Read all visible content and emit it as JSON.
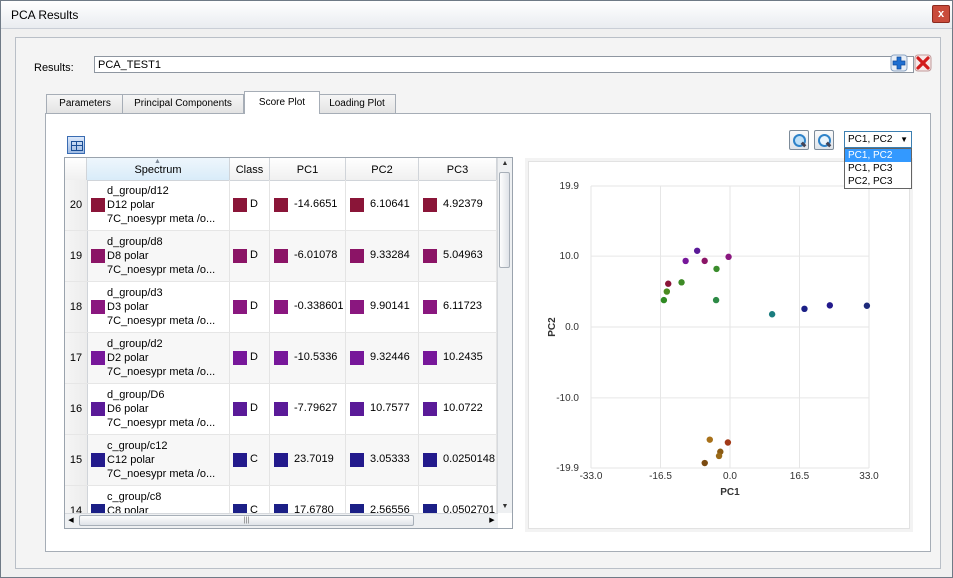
{
  "window": {
    "title": "PCA Results",
    "close_glyph": "x"
  },
  "results": {
    "label": "Results:",
    "value": "PCA_TEST1",
    "add_icon": "plus-icon",
    "delete_icon": "delete-x-icon"
  },
  "tabs": [
    {
      "label": "Parameters",
      "active": false
    },
    {
      "label": "Principal Components",
      "active": false
    },
    {
      "label": "Score Plot",
      "active": true
    },
    {
      "label": "Loading Plot",
      "active": false
    }
  ],
  "toolbar": {
    "pc_select_value": "PC1, PC2",
    "pc_options": [
      "PC1, PC2",
      "PC1, PC3",
      "PC2, PC3"
    ],
    "selected_option": "PC1, PC2"
  },
  "table": {
    "columns": [
      "Spectrum",
      "Class",
      "PC1",
      "PC2",
      "PC3"
    ],
    "rows": [
      {
        "num": "20",
        "spectrum": [
          "d_group/d12",
          "D12 polar",
          "7C_noesypr meta /o..."
        ],
        "class": "D",
        "pc1": "-14.6651",
        "pc2": "6.10641",
        "pc3": "4.92379",
        "color": "#8a1538"
      },
      {
        "num": "19",
        "spectrum": [
          "d_group/d8",
          "D8 polar",
          "7C_noesypr meta /o..."
        ],
        "class": "D",
        "pc1": "-6.01078",
        "pc2": "9.33284",
        "pc3": "5.04963",
        "color": "#8b1466"
      },
      {
        "num": "18",
        "spectrum": [
          "d_group/d3",
          "D3 polar",
          "7C_noesypr meta /o..."
        ],
        "class": "D",
        "pc1": "-0.338601",
        "pc2": "9.90141",
        "pc3": "6.11723",
        "color": "#8a177f"
      },
      {
        "num": "17",
        "spectrum": [
          "d_group/d2",
          "D2 polar",
          "7C_noesypr meta /o..."
        ],
        "class": "D",
        "pc1": "-10.5336",
        "pc2": "9.32446",
        "pc3": "10.2435",
        "color": "#77179a"
      },
      {
        "num": "16",
        "spectrum": [
          "d_group/D6",
          "D6 polar",
          "7C_noesypr meta /o..."
        ],
        "class": "D",
        "pc1": "-7.79627",
        "pc2": "10.7577",
        "pc3": "10.0722",
        "color": "#5a1a98"
      },
      {
        "num": "15",
        "spectrum": [
          "c_group/c12",
          "C12 polar",
          "7C_noesypr meta /o..."
        ],
        "class": "C",
        "pc1": "23.7019",
        "pc2": "3.05333",
        "pc3": "0.0250148",
        "color": "#231a8c"
      },
      {
        "num": "14",
        "spectrum": [
          "c_group/c8",
          "C8 polar",
          ""
        ],
        "class": "C",
        "pc1": "17.6780",
        "pc2": "2.56556",
        "pc3": "0.0502701",
        "color": "#1b1f86"
      }
    ]
  },
  "chart_data": {
    "type": "scatter",
    "xlabel": "PC1",
    "ylabel": "PC2",
    "xlim": [
      -33.0,
      33.0
    ],
    "ylim": [
      -19.9,
      19.9
    ],
    "xticks": [
      "-33.0",
      "-16.5",
      "0.0",
      "16.5",
      "33.0"
    ],
    "yticks": [
      "19.9",
      "10.0",
      "0.0",
      "-10.0",
      "-19.9"
    ],
    "grid": true,
    "points": [
      {
        "x": -14.6651,
        "y": 6.10641,
        "color": "#8a1538"
      },
      {
        "x": -6.01078,
        "y": 9.33284,
        "color": "#8b1466"
      },
      {
        "x": -0.338601,
        "y": 9.90141,
        "color": "#8a177f"
      },
      {
        "x": -10.5336,
        "y": 9.32446,
        "color": "#77179a"
      },
      {
        "x": -7.79627,
        "y": 10.7577,
        "color": "#5a1a98"
      },
      {
        "x": 23.7019,
        "y": 3.05333,
        "color": "#231a8c"
      },
      {
        "x": 17.678,
        "y": 2.56556,
        "color": "#1b1f86"
      },
      {
        "x": 32.5,
        "y": 3.0,
        "color": "#1d2a7a"
      },
      {
        "x": 10.0,
        "y": 1.8,
        "color": "#1a7d7f"
      },
      {
        "x": -15.7,
        "y": 3.8,
        "color": "#2f8a22"
      },
      {
        "x": -15.0,
        "y": 5.0,
        "color": "#4a8b1f"
      },
      {
        "x": -11.5,
        "y": 6.3,
        "color": "#3d8a25"
      },
      {
        "x": -3.2,
        "y": 8.2,
        "color": "#3a8c2c"
      },
      {
        "x": -3.3,
        "y": 3.8,
        "color": "#2d8a46"
      },
      {
        "x": -4.8,
        "y": -15.9,
        "color": "#a8711a"
      },
      {
        "x": -0.5,
        "y": -16.3,
        "color": "#a23a18"
      },
      {
        "x": -2.3,
        "y": -17.6,
        "color": "#8a5a12"
      },
      {
        "x": -2.6,
        "y": -18.2,
        "color": "#9a6a18"
      },
      {
        "x": -6.0,
        "y": -19.2,
        "color": "#7a4a10"
      }
    ]
  }
}
